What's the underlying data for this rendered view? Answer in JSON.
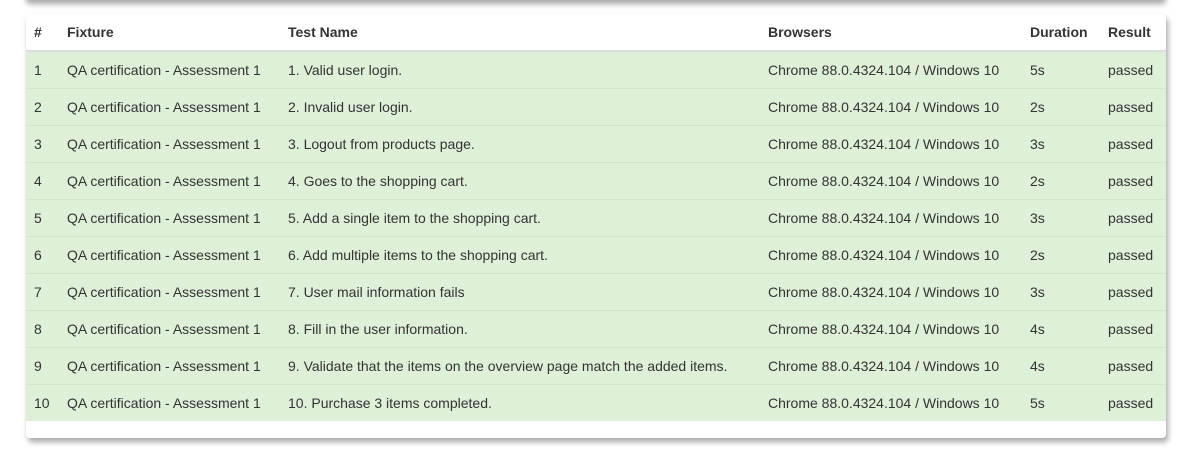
{
  "colors": {
    "row_passed_bg": "#dff0d8",
    "text": "#333333",
    "header_border": "#dddddd"
  },
  "table": {
    "headers": [
      "#",
      "Fixture",
      "Test Name",
      "Browsers",
      "Duration",
      "Result"
    ],
    "rows": [
      [
        "1",
        "QA certification - Assessment 1",
        "1. Valid user login.",
        "Chrome 88.0.4324.104 / Windows 10",
        "5s",
        "passed"
      ],
      [
        "2",
        "QA certification - Assessment 1",
        "2. Invalid user login.",
        "Chrome 88.0.4324.104 / Windows 10",
        "2s",
        "passed"
      ],
      [
        "3",
        "QA certification - Assessment 1",
        "3. Logout from products page.",
        "Chrome 88.0.4324.104 / Windows 10",
        "3s",
        "passed"
      ],
      [
        "4",
        "QA certification - Assessment 1",
        "4. Goes to the shopping cart.",
        "Chrome 88.0.4324.104 / Windows 10",
        "2s",
        "passed"
      ],
      [
        "5",
        "QA certification - Assessment 1",
        "5. Add a single item to the shopping cart.",
        "Chrome 88.0.4324.104 / Windows 10",
        "3s",
        "passed"
      ],
      [
        "6",
        "QA certification - Assessment 1",
        "6. Add multiple items to the shopping cart.",
        "Chrome 88.0.4324.104 / Windows 10",
        "2s",
        "passed"
      ],
      [
        "7",
        "QA certification - Assessment 1",
        "7. User mail information fails",
        "Chrome 88.0.4324.104 / Windows 10",
        "3s",
        "passed"
      ],
      [
        "8",
        "QA certification - Assessment 1",
        "8. Fill in the user information.",
        "Chrome 88.0.4324.104 / Windows 10",
        "4s",
        "passed"
      ],
      [
        "9",
        "QA certification - Assessment 1",
        "9. Validate that the items on the overview page match the added items.",
        "Chrome 88.0.4324.104 / Windows 10",
        "4s",
        "passed"
      ],
      [
        "10",
        "QA certification - Assessment 1",
        "10. Purchase 3 items completed.",
        "Chrome 88.0.4324.104 / Windows 10",
        "5s",
        "passed"
      ]
    ]
  }
}
